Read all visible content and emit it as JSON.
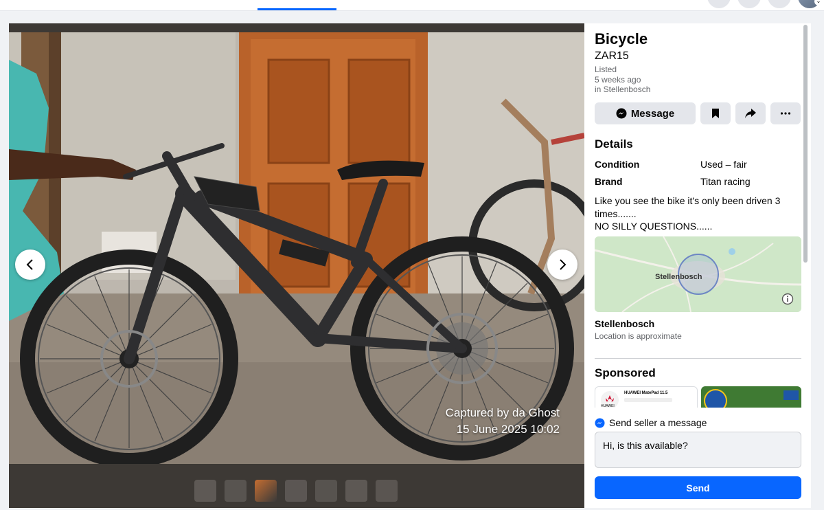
{
  "listing": {
    "title": "Bicycle",
    "price": "ZAR15",
    "listed_label": "Listed",
    "listed_time": "5 weeks ago",
    "listed_location": "in Stellenbosch"
  },
  "actions": {
    "message_label": "Message",
    "save_icon": "bookmark-icon",
    "share_icon": "share-icon",
    "more_icon": "more-icon"
  },
  "details": {
    "heading": "Details",
    "rows": [
      {
        "key": "Condition",
        "value": "Used – fair"
      },
      {
        "key": "Brand",
        "value": "Titan racing"
      }
    ],
    "description_lines": [
      "Like you see the bike it's only been driven 3",
      "times.......",
      "NO SILLY QUESTIONS......"
    ]
  },
  "map": {
    "label": "Stellenbosch",
    "location_name": "Stellenbosch",
    "location_note": "Location is approximate"
  },
  "sponsored": {
    "heading": "Sponsored",
    "ad1_brand": "HUAWEI",
    "ad1_product": "HUAWEI MatePad 11.5"
  },
  "photo": {
    "watermark_line1": "Captured by da Ghost",
    "watermark_line2": "15 June 2025 10:02",
    "thumbnail_count": 7,
    "active_thumbnail": 3
  },
  "message": {
    "label": "Send seller a message",
    "input_value": "Hi, is this available?",
    "send_label": "Send"
  },
  "colors": {
    "accent": "#0866ff",
    "background": "#f0f2f5",
    "secondary_text": "#65676b"
  }
}
